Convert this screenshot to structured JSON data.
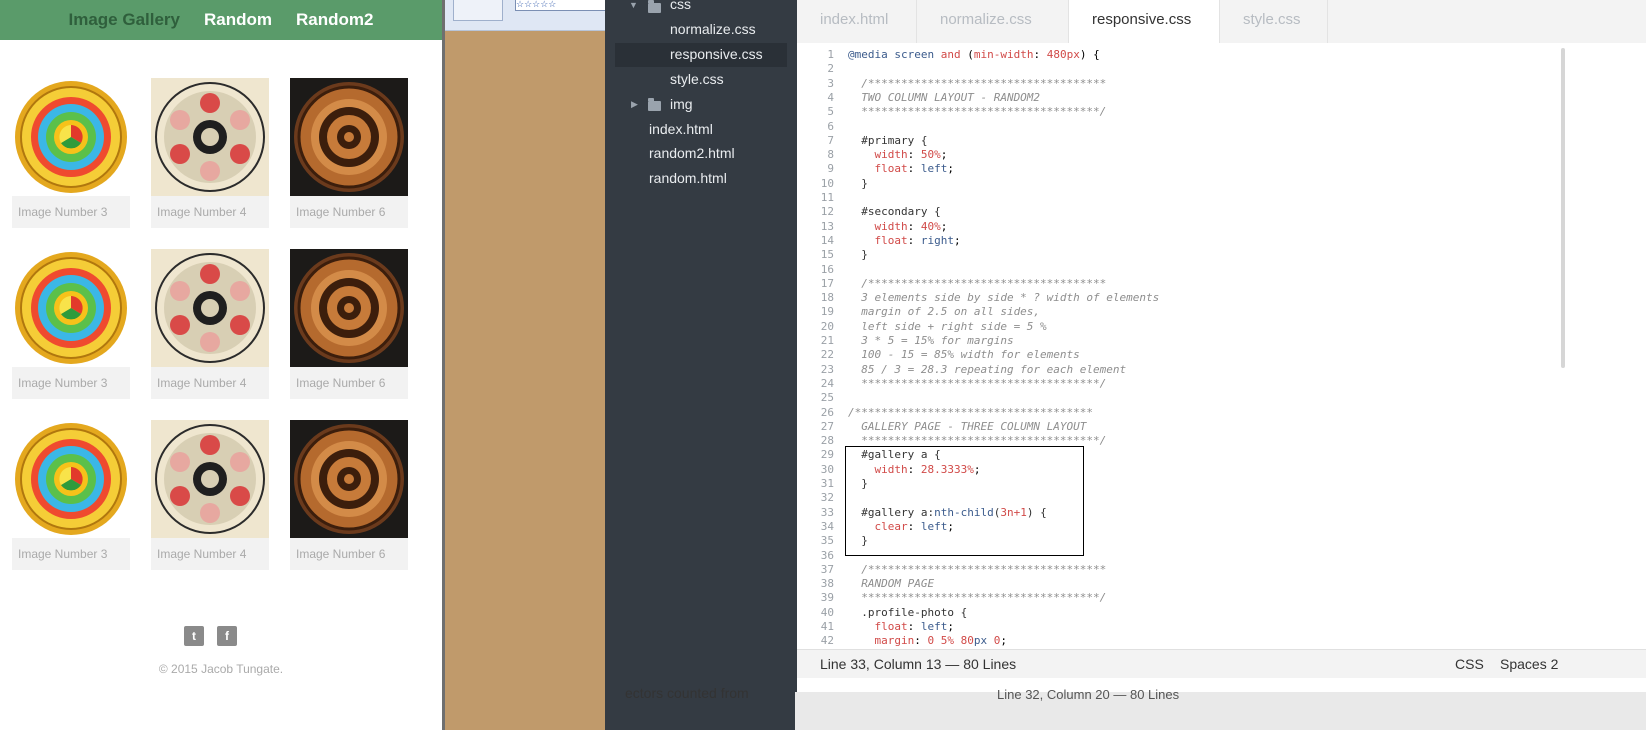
{
  "preview": {
    "nav": [
      "Image Gallery",
      "Random",
      "Random2"
    ],
    "gallery": [
      [
        "Image Number 3",
        "Image Number 4",
        "Image Number 6"
      ],
      [
        "Image Number 3",
        "Image Number 4",
        "Image Number 6"
      ],
      [
        "Image Number 3",
        "Image Number 4",
        "Image Number 6"
      ]
    ],
    "social": {
      "twitter": "twitter-icon",
      "facebook": "facebook-icon"
    },
    "copyright": "© 2015 Jacob Tungate."
  },
  "sidebar": {
    "items": [
      {
        "label": "css",
        "type": "folder-open"
      },
      {
        "label": "normalize.css",
        "type": "file"
      },
      {
        "label": "responsive.css",
        "type": "file",
        "selected": true
      },
      {
        "label": "style.css",
        "type": "file"
      },
      {
        "label": "img",
        "type": "folder-closed"
      },
      {
        "label": "index.html",
        "type": "file"
      },
      {
        "label": "random2.html",
        "type": "file"
      },
      {
        "label": "random.html",
        "type": "file"
      }
    ]
  },
  "tabs": [
    "index.html",
    "normalize.css",
    "responsive.css",
    "style.css"
  ],
  "active_tab": "responsive.css",
  "code": {
    "lines": [
      "@media screen and (min-width: 480px) {",
      "",
      "  /************************************",
      "  TWO COLUMN LAYOUT - RANDOM2",
      "  ************************************/",
      "",
      "  #primary {",
      "    width: 50%;",
      "    float: left;",
      "  }",
      "",
      "  #secondary {",
      "    width: 40%;",
      "    float: right;",
      "  }",
      "",
      "  /************************************",
      "  3 elements side by side * ? width of elements",
      "  margin of 2.5 on all sides,",
      "  left side + right side = 5 %",
      "  3 * 5 = 15% for margins",
      "  100 - 15 = 85% width for elements",
      "  85 / 3 = 28.3 repeating for each element",
      "  ************************************/",
      "",
      "/************************************",
      "  GALLERY PAGE - THREE COLUMN LAYOUT",
      "  ************************************/",
      "  #gallery a {",
      "    width: 28.3333%;",
      "  }",
      "",
      "  #gallery a:nth-child(3n+1) {",
      "    clear: left;",
      "  }",
      "",
      "  /************************************",
      "  RANDOM PAGE",
      "  ************************************/",
      "  .profile-photo {",
      "    float: left;",
      "    margin: 0 5% 80px 0;"
    ]
  },
  "status": {
    "position": "Line 33, Column 13 — 80 Lines",
    "syntax": "CSS",
    "indent": "Spaces 2"
  },
  "below_ghost": {
    "left": "ectors counted from",
    "right": "Line 32, Column 20 — 80 Lines"
  },
  "colors": {
    "nav_green": "#5a9b6a",
    "sidebar_bg": "#343b43",
    "tan_bg": "#c09a6b",
    "property_red": "#d14a48",
    "keyword_blue": "#3b5b8c"
  }
}
